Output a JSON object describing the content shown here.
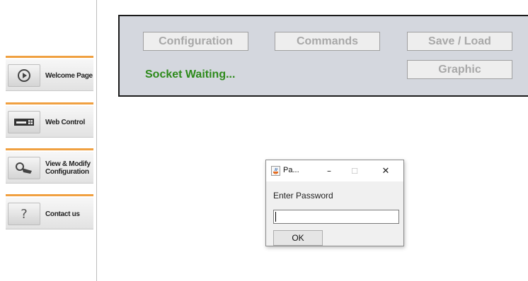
{
  "sidebar": {
    "items": [
      {
        "label": "Welcome Page",
        "icon": "play-circle-icon"
      },
      {
        "label": "Web Control",
        "icon": "keyboard-device-icon"
      },
      {
        "label": "View & Modify\nConfiguration",
        "icon": "hand-pointer-icon"
      },
      {
        "label": "Contact us",
        "icon": "question-icon"
      }
    ]
  },
  "panel": {
    "configuration_label": "Configuration",
    "commands_label": "Commands",
    "save_load_label": "Save / Load",
    "graphic_label": "Graphic",
    "status": "Socket Waiting..."
  },
  "dialog": {
    "title": "Pa...",
    "minimize_glyph": "–",
    "maximize_glyph": "☐",
    "close_glyph": "✕",
    "prompt": "Enter Password",
    "password_value": "",
    "ok_label": "OK"
  },
  "colors": {
    "accent_orange": "#f0a040",
    "panel_bg": "#d4d7de",
    "status_green": "#2d8a1a"
  }
}
